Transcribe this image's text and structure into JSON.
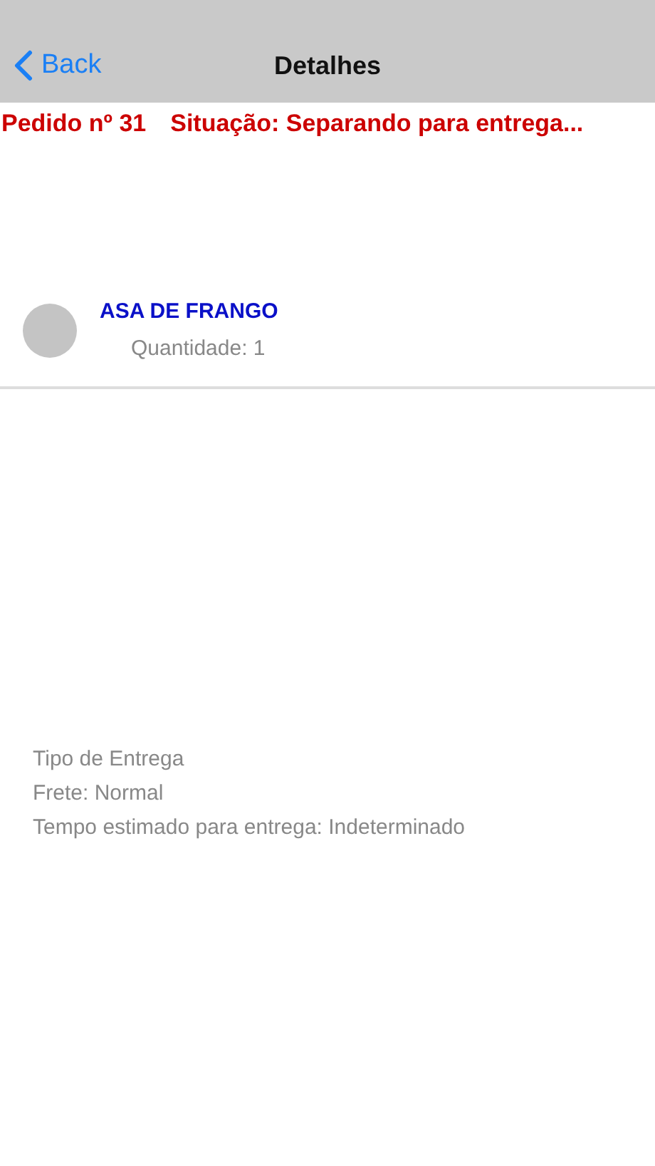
{
  "nav_bar": {
    "back": "Back",
    "title": "Detalhes"
  },
  "order": {
    "number": "Pedido nº 31",
    "status": "Situação: Separando para entrega..."
  },
  "items": [
    {
      "name": "ASA DE FRANGO",
      "quantity": "Quantidade: 1"
    }
  ],
  "delivery": [
    "Tipo de Entrega",
    "Frete: Normal",
    "Tempo estimado para entrega: Indeterminado"
  ]
}
